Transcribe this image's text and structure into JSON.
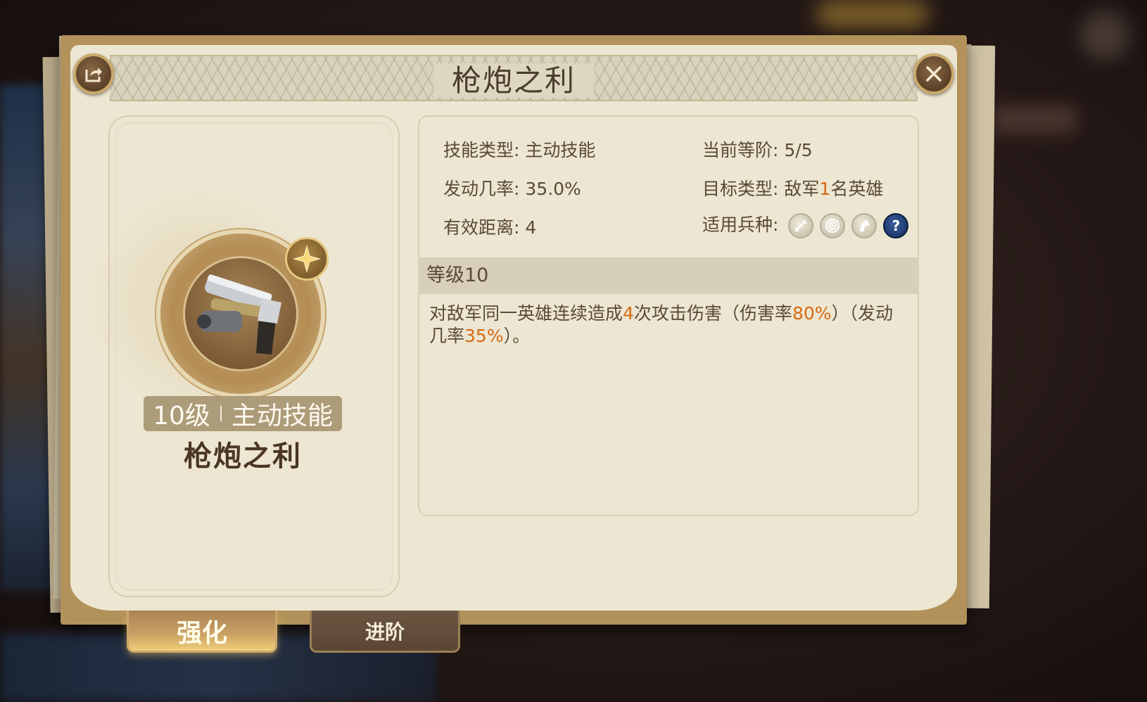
{
  "dialog": {
    "title": "枪炮之利"
  },
  "skill_card": {
    "level": "10级",
    "type": "主动技能",
    "name": "枪炮之利"
  },
  "info": {
    "skill_type_label": "技能类型:",
    "skill_type_value": "主动技能",
    "current_rank_label": "当前等阶:",
    "current_rank_value": "5/5",
    "trigger_rate_label": "发动几率:",
    "trigger_rate_value": "35.0%",
    "target_type_label": "目标类型:",
    "target_type_prefix": "敌军",
    "target_type_count": "1",
    "target_type_suffix": "名英雄",
    "range_label": "有效距离:",
    "range_value": "4",
    "units_label": "适用兵种:",
    "unit_icons": [
      "sword-icon",
      "target-icon",
      "horse-icon",
      "help-icon"
    ],
    "help_glyph": "?"
  },
  "grade": {
    "label": "等级10"
  },
  "description": {
    "p1": "对敌军同一英雄连续造成",
    "hits": "4",
    "p2": "次攻击伤害（伤害率",
    "damage_rate": "80%",
    "p3": "）（发动几率",
    "trigger_rate": "35%",
    "p4": "）。"
  },
  "tabs": [
    {
      "label": "强化",
      "active": true
    },
    {
      "label": "进阶",
      "active": false
    }
  ],
  "colors": {
    "accent": "#d56a14",
    "panel_border": "#b2925a",
    "paper": "#ede6d2",
    "text": "#5a4a38"
  }
}
